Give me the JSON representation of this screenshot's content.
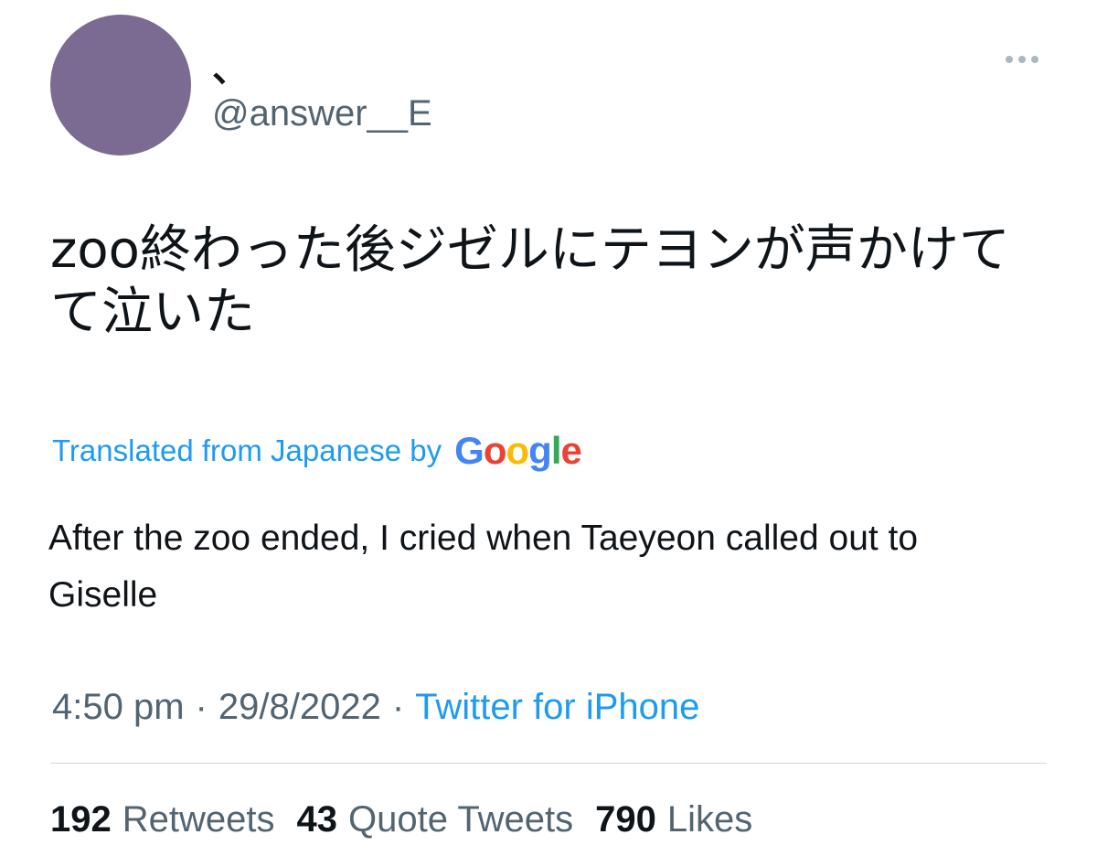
{
  "author": {
    "display_name": "、",
    "handle": "@answer__E",
    "avatar_color": "#7b6a92"
  },
  "more_icon": "more-horizontal-icon",
  "tweet": {
    "text": "zoo終わった後ジゼルにテヨンが声かけてて泣いた"
  },
  "translation": {
    "label": "Translated from Japanese by",
    "provider_letters": [
      "G",
      "o",
      "o",
      "g",
      "l",
      "e"
    ],
    "text": "After the zoo ended, I cried when Taeyeon called out to Giselle"
  },
  "meta": {
    "time": "4:50 pm",
    "separator": "·",
    "date": "29/8/2022",
    "source": "Twitter for iPhone"
  },
  "stats": {
    "retweets_count": "192",
    "retweets_label": "Retweets",
    "quotes_count": "43",
    "quotes_label": "Quote Tweets",
    "likes_count": "790",
    "likes_label": "Likes"
  },
  "colors": {
    "link": "#1d9bf0",
    "secondary_text": "#536471",
    "primary_text": "#0f1419",
    "divider": "#cfd9de"
  }
}
